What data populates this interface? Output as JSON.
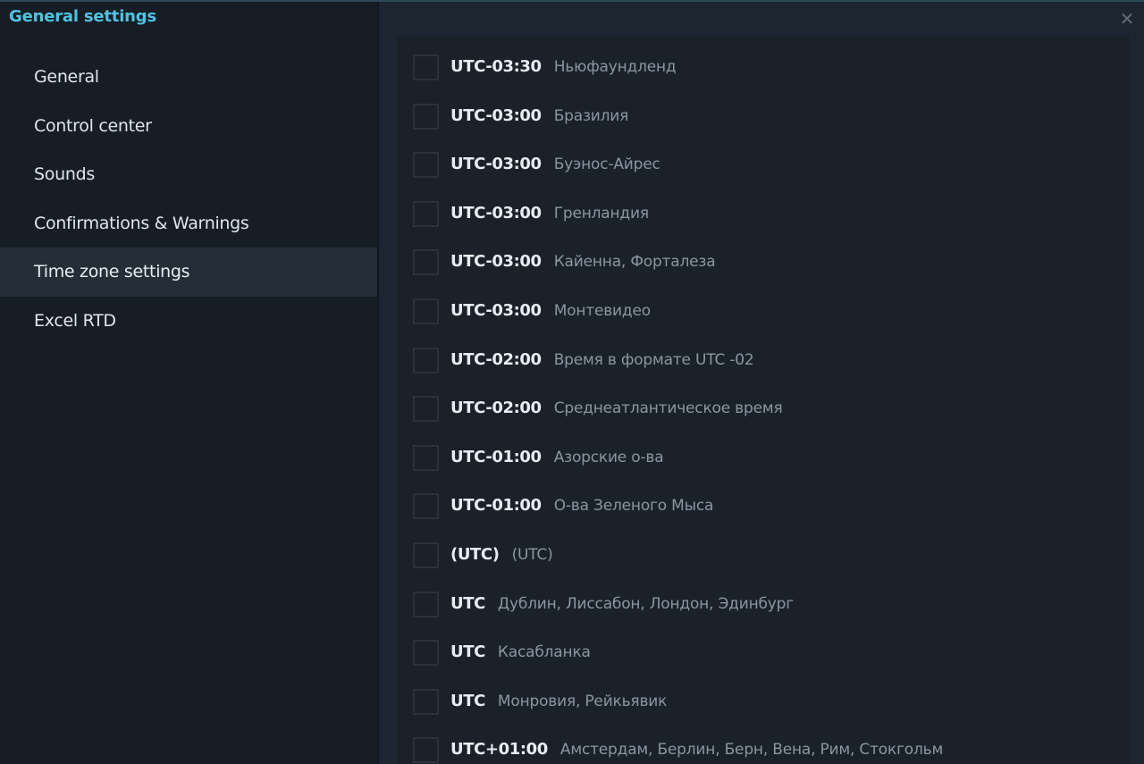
{
  "window": {
    "title": "General settings",
    "close_icon": "close-icon"
  },
  "sidebar": {
    "items": [
      {
        "label": "General"
      },
      {
        "label": "Control center"
      },
      {
        "label": "Sounds"
      },
      {
        "label": "Confirmations & Warnings"
      },
      {
        "label": "Time zone settings",
        "active": true
      },
      {
        "label": "Excel RTD"
      }
    ]
  },
  "timezones": [
    {
      "offset": "UTC-03:30",
      "name": "Ньюфаундленд",
      "checked": false
    },
    {
      "offset": "UTC-03:00",
      "name": "Бразилия",
      "checked": false
    },
    {
      "offset": "UTC-03:00",
      "name": "Буэнос-Айрес",
      "checked": false
    },
    {
      "offset": "UTC-03:00",
      "name": "Гренландия",
      "checked": false
    },
    {
      "offset": "UTC-03:00",
      "name": "Кайенна, Форталеза",
      "checked": false
    },
    {
      "offset": "UTC-03:00",
      "name": "Монтевидео",
      "checked": false
    },
    {
      "offset": "UTC-02:00",
      "name": "Время в формате UTC -02",
      "checked": false
    },
    {
      "offset": "UTC-02:00",
      "name": "Среднеатлантическое время",
      "checked": false
    },
    {
      "offset": "UTC-01:00",
      "name": "Азорские о-ва",
      "checked": false
    },
    {
      "offset": "UTC-01:00",
      "name": "О-ва Зеленого Мыса",
      "checked": false
    },
    {
      "offset": "(UTC)",
      "name": "(UTC)",
      "checked": false
    },
    {
      "offset": "UTC",
      "name": "Дублин, Лиссабон, Лондон, Эдинбург",
      "checked": false
    },
    {
      "offset": "UTC",
      "name": "Касабланка",
      "checked": false
    },
    {
      "offset": "UTC",
      "name": "Монровия, Рейкьявик",
      "checked": false
    },
    {
      "offset": "UTC+01:00",
      "name": "Амстердам, Берлин, Берн, Вена, Рим, Стокгольм",
      "checked": false
    }
  ],
  "colors": {
    "accent": "#4fc3e0",
    "sidebar_bg": "#161d25",
    "active_item_bg": "#252d37",
    "content_bg": "#1a2129"
  }
}
